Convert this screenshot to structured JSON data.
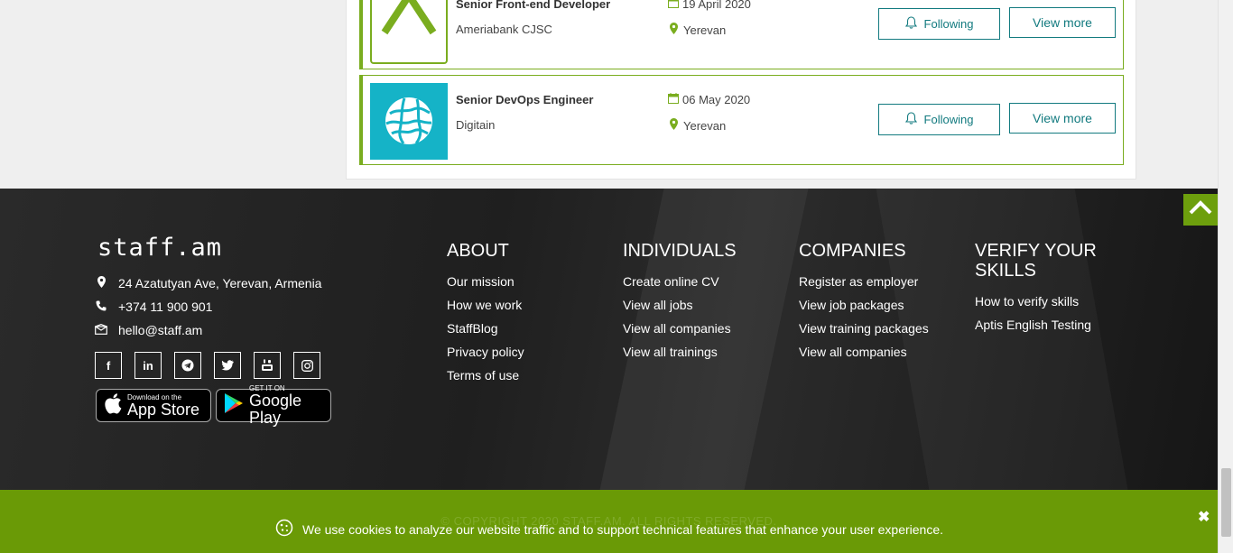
{
  "jobs": [
    {
      "title": "Senior Front-end Developer",
      "company": "Ameriabank CJSC",
      "date": "19 April 2020",
      "location": "Yerevan",
      "follow_label": "Following",
      "more_label": "View more"
    },
    {
      "title": "Senior DevOps Engineer",
      "company": "Digitain",
      "date": "06 May 2020",
      "location": "Yerevan",
      "follow_label": "Following",
      "more_label": "View more"
    }
  ],
  "footer": {
    "brand": "staff.am",
    "address": "24 Azatutyan Ave, Yerevan, Armenia",
    "phone": "+374 11 900 901",
    "email": "hello@staff.am",
    "socials": [
      "facebook-icon",
      "linkedin-icon",
      "telegram-icon",
      "twitter-icon",
      "youtube-icon",
      "instagram-icon"
    ],
    "app_store": {
      "small": "Download on the",
      "big": "App Store"
    },
    "google_play": {
      "small": "GET IT ON",
      "big": "Google Play"
    },
    "columns": [
      {
        "heading": "ABOUT",
        "links": [
          "Our mission",
          "How we work",
          "StaffBlog",
          "Privacy policy",
          "Terms of use"
        ]
      },
      {
        "heading": "INDIVIDUALS",
        "links": [
          "Create online CV",
          "View all jobs",
          "View all companies",
          "View all trainings"
        ]
      },
      {
        "heading": "COMPANIES",
        "links": [
          "Register as employer",
          "View job packages",
          "View training packages",
          "View all companies"
        ]
      },
      {
        "heading": "VERIFY YOUR SKILLS",
        "links": [
          "How to verify skills",
          "Aptis English Testing"
        ]
      }
    ],
    "copyright": "© COPYRIGHT 2020 STAFF.AM. ALL RIGHTS RESERVED."
  },
  "cookie": {
    "text": "We use cookies to analyze our website traffic and to support technical features that enhance your user experience.",
    "close": "✖"
  },
  "colors": {
    "accent_green": "#7aad1f",
    "teal": "#127a7f",
    "cookie_bg": "#6a9a06",
    "digitain_bg": "#15b3c7"
  }
}
